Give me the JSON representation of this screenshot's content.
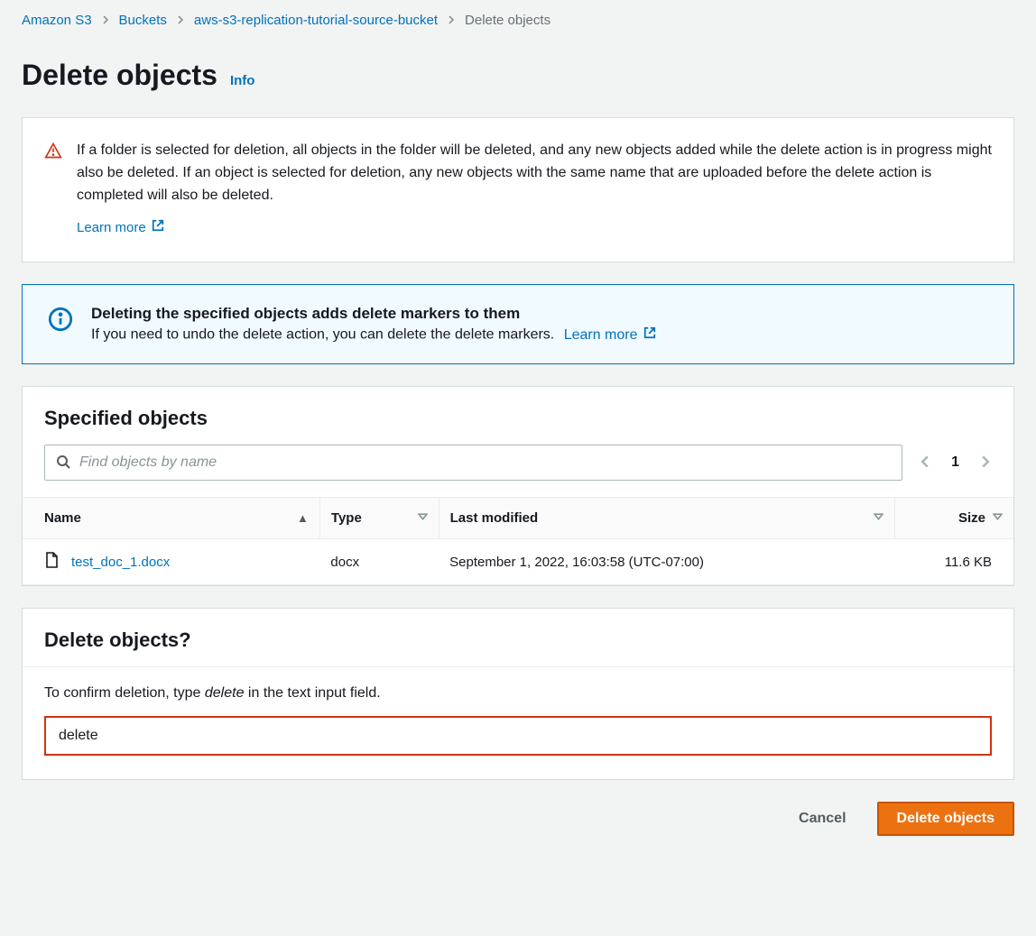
{
  "breadcrumb": {
    "items": [
      {
        "label": "Amazon S3",
        "link": true
      },
      {
        "label": "Buckets",
        "link": true
      },
      {
        "label": "aws-s3-replication-tutorial-source-bucket",
        "link": true
      },
      {
        "label": "Delete objects",
        "link": false
      }
    ]
  },
  "header": {
    "title": "Delete objects",
    "info_label": "Info"
  },
  "warning": {
    "text": "If a folder is selected for deletion, all objects in the folder will be deleted, and any new objects added while the delete action is in progress might also be deleted. If an object is selected for deletion, any new objects with the same name that are uploaded before the delete action is completed will also be deleted.",
    "learn_more": "Learn more"
  },
  "info_alert": {
    "title": "Deleting the specified objects adds delete markers to them",
    "desc": "If you need to undo the delete action, you can delete the delete markers.",
    "learn_more": "Learn more"
  },
  "specified": {
    "title": "Specified objects",
    "search_placeholder": "Find objects by name",
    "page": "1",
    "columns": {
      "name": "Name",
      "type": "Type",
      "modified": "Last modified",
      "size": "Size"
    },
    "rows": [
      {
        "name": "test_doc_1.docx",
        "type": "docx",
        "modified": "September 1, 2022, 16:03:58 (UTC-07:00)",
        "size": "11.6 KB"
      }
    ]
  },
  "confirm": {
    "title": "Delete objects?",
    "instr_prefix": "To confirm deletion, type ",
    "instr_keyword": "delete",
    "instr_suffix": " in the text input field.",
    "input_value": "delete"
  },
  "actions": {
    "cancel": "Cancel",
    "submit": "Delete objects"
  }
}
